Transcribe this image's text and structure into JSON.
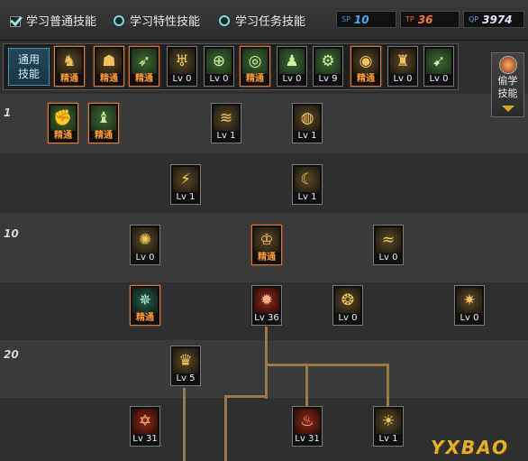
{
  "tabs": [
    {
      "label": "学习普通技能",
      "selected": true
    },
    {
      "label": "学习特性技能",
      "selected": false
    },
    {
      "label": "学习任务技能",
      "selected": false
    }
  ],
  "counters": {
    "sp": {
      "tag": "SP",
      "value": "10",
      "color": "#4fa8ff"
    },
    "tp": {
      "tag": "TP",
      "value": "36",
      "color": "#ff7a40"
    },
    "qp": {
      "tag": "QP",
      "value": "3974",
      "color": "#7ab0ff"
    }
  },
  "general_skills_label": "通用\n技能",
  "steal_panel": {
    "label": "偷学\n技能"
  },
  "level_labels": {
    "l1": "1",
    "l10": "10",
    "l20": "20"
  },
  "master_label": "精通",
  "top_skills": [
    {
      "icon": "sitting-figure-icon",
      "level": "精通",
      "master": true,
      "tone": "gold"
    },
    {
      "icon": "crouching-figure-icon",
      "level": "精通",
      "master": true,
      "tone": "gold"
    },
    {
      "icon": "dash-strike-icon",
      "level": "精通",
      "master": true,
      "tone": "green"
    },
    {
      "icon": "eagle-wings-icon",
      "level": "Lv 0",
      "master": false,
      "tone": "gold"
    },
    {
      "icon": "crosshair-icon",
      "level": "Lv 0",
      "master": false,
      "tone": "green"
    },
    {
      "icon": "target-icon",
      "level": "精通",
      "master": true,
      "tone": "green"
    },
    {
      "icon": "fighter-stance-icon",
      "level": "Lv 0",
      "master": false,
      "tone": "green"
    },
    {
      "icon": "gear-figure-icon",
      "level": "Lv 9",
      "master": false,
      "tone": "green"
    },
    {
      "icon": "vortex-icon",
      "level": "精通",
      "master": true,
      "tone": "gold"
    },
    {
      "icon": "muscle-figure-icon",
      "level": "Lv 0",
      "master": false,
      "tone": "gold"
    },
    {
      "icon": "runner-icon",
      "level": "Lv 0",
      "master": false,
      "tone": "green"
    }
  ],
  "tree_skills": [
    {
      "icon": "explosion-fist-icon",
      "level": "精通",
      "master": true,
      "tone": "green"
    },
    {
      "icon": "kick-figure-icon",
      "level": "精通",
      "master": true,
      "tone": "green"
    },
    {
      "icon": "swirl-strike-icon",
      "level": "Lv 1",
      "master": false,
      "tone": "gold"
    },
    {
      "icon": "tornado-icon",
      "level": "Lv 1",
      "master": false,
      "tone": "gold"
    },
    {
      "icon": "claw-slash-icon",
      "level": "Lv 1",
      "master": false,
      "tone": "gold"
    },
    {
      "icon": "crescent-icon",
      "level": "Lv 1",
      "master": false,
      "tone": "gold"
    },
    {
      "icon": "flame-burst-icon",
      "level": "Lv 0",
      "master": false,
      "tone": "gold"
    },
    {
      "icon": "golden-warrior-icon",
      "level": "精通",
      "master": true,
      "tone": "gold"
    },
    {
      "icon": "wave-dragon-icon",
      "level": "Lv 0",
      "master": false,
      "tone": "gold"
    },
    {
      "icon": "green-burst-icon",
      "level": "精通",
      "master": true,
      "tone": "teal"
    },
    {
      "icon": "red-orbit-icon",
      "level": "Lv 36",
      "master": false,
      "tone": "red"
    },
    {
      "icon": "spiral-orb-icon",
      "level": "Lv 0",
      "master": false,
      "tone": "gold"
    },
    {
      "icon": "shatter-icon",
      "level": "Lv 0",
      "master": false,
      "tone": "gold"
    },
    {
      "icon": "golden-crown-icon",
      "level": "Lv 5",
      "master": false,
      "tone": "gold"
    },
    {
      "icon": "red-sigil-icon",
      "level": "Lv 31",
      "master": false,
      "tone": "red"
    },
    {
      "icon": "red-flames-icon",
      "level": "Lv 31",
      "master": false,
      "tone": "red"
    },
    {
      "icon": "radiant-warrior-icon",
      "level": "Lv 1",
      "master": false,
      "tone": "gold"
    }
  ],
  "glyphs": {
    "sitting-figure-icon": "♞",
    "crouching-figure-icon": "☗",
    "dash-strike-icon": "➶",
    "eagle-wings-icon": "♅",
    "crosshair-icon": "⊕",
    "target-icon": "◎",
    "fighter-stance-icon": "♟",
    "gear-figure-icon": "⚙",
    "vortex-icon": "◉",
    "muscle-figure-icon": "♜",
    "runner-icon": "➹",
    "explosion-fist-icon": "✊",
    "kick-figure-icon": "♝",
    "swirl-strike-icon": "≋",
    "tornado-icon": "◍",
    "claw-slash-icon": "⚡",
    "crescent-icon": "☾",
    "flame-burst-icon": "✺",
    "golden-warrior-icon": "♔",
    "wave-dragon-icon": "≈",
    "green-burst-icon": "✵",
    "red-orbit-icon": "✹",
    "spiral-orb-icon": "❂",
    "shatter-icon": "✷",
    "golden-crown-icon": "♛",
    "red-sigil-icon": "✡",
    "red-flames-icon": "♨",
    "radiant-warrior-icon": "☀"
  },
  "watermark": "YXBAO"
}
